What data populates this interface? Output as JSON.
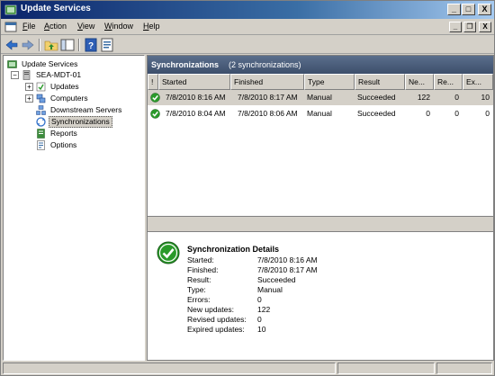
{
  "window": {
    "title": "Update Services",
    "minimize_glyph": "_",
    "maximize_glyph": "□",
    "close_glyph": "X"
  },
  "menu": {
    "items": [
      {
        "key": "F",
        "rest": "ile"
      },
      {
        "key": "A",
        "rest": "ction"
      },
      {
        "key": "V",
        "rest": "iew"
      },
      {
        "key": "W",
        "rest": "indow"
      },
      {
        "key": "H",
        "rest": "elp"
      }
    ],
    "mdi_min": "_",
    "mdi_restore": "❐",
    "mdi_close": "X"
  },
  "toolbar": {
    "icons": [
      "back-arrow-icon",
      "forward-arrow-icon",
      "up-folder-icon",
      "show-hide-tree-icon",
      "help-icon",
      "properties-icon"
    ]
  },
  "tree": {
    "root": "Update Services",
    "server": "SEA-MDT-01",
    "children": [
      "Updates",
      "Computers",
      "Downstream Servers",
      "Synchronizations",
      "Reports",
      "Options"
    ],
    "selected": "Synchronizations"
  },
  "pane": {
    "title": "Synchronizations",
    "count": "(2 synchronizations)"
  },
  "grid": {
    "columns": [
      "!",
      "Started",
      "Finished",
      "Type",
      "Result",
      "Ne...",
      "Re...",
      "Ex..."
    ],
    "rows": [
      {
        "started": "7/8/2010 8:16 AM",
        "finished": "7/8/2010 8:17 AM",
        "type": "Manual",
        "result": "Succeeded",
        "new": "122",
        "revised": "0",
        "expired": "10"
      },
      {
        "started": "7/8/2010 8:04 AM",
        "finished": "7/8/2010 8:06 AM",
        "type": "Manual",
        "result": "Succeeded",
        "new": "0",
        "revised": "0",
        "expired": "0"
      }
    ]
  },
  "details": {
    "title": "Synchronization Details",
    "fields": [
      {
        "label": "Started:",
        "value": "7/8/2010 8:16 AM"
      },
      {
        "label": "Finished:",
        "value": "7/8/2010 8:17 AM"
      },
      {
        "label": "Result:",
        "value": "Succeeded"
      },
      {
        "label": "Type:",
        "value": "Manual"
      },
      {
        "label": "Errors:",
        "value": "0"
      },
      {
        "label": "New updates:",
        "value": "122"
      },
      {
        "label": "Revised updates:",
        "value": "0"
      },
      {
        "label": "Expired updates:",
        "value": "10"
      }
    ]
  },
  "colors": {
    "title_bar_start": "#0a246a",
    "title_bar_end": "#a6caf0",
    "pane_header": "#4a5c7a",
    "success_green": "#2a9a2a",
    "chrome": "#d4d0c8"
  }
}
